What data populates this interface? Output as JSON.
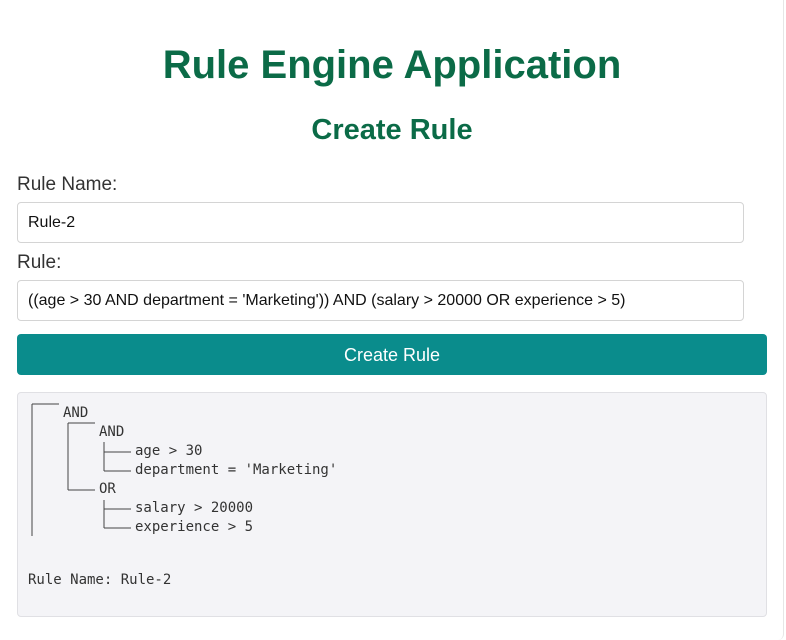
{
  "header": {
    "title": "Rule Engine Application",
    "section_title": "Create Rule"
  },
  "form": {
    "rule_name_label": "Rule Name:",
    "rule_name_value": "Rule-2",
    "rule_label": "Rule:",
    "rule_value": "((age > 30 AND department = 'Marketing')) AND (salary > 20000 OR experience > 5)",
    "submit_label": "Create Rule"
  },
  "output": {
    "tree": {
      "root": "AND",
      "left_op": "AND",
      "left_cond_1": "age > 30",
      "left_cond_2": "department = 'Marketing'",
      "right_op": "OR",
      "right_cond_1": "salary > 20000",
      "right_cond_2": "experience > 5"
    },
    "rule_name_line": "Rule Name: Rule-2"
  },
  "colors": {
    "title": "#0b6b47",
    "button": "#0a8c8c",
    "panel_bg": "#f4f4f7"
  }
}
